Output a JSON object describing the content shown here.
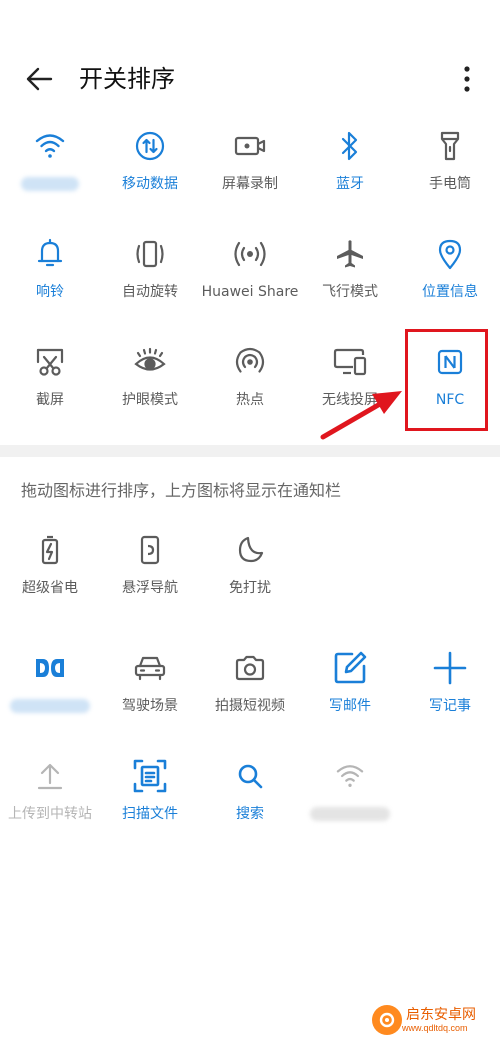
{
  "header": {
    "title": "开关排序"
  },
  "active_switches": [
    {
      "label": "",
      "icon": "wifi-icon",
      "state": "on"
    },
    {
      "label": "移动数据",
      "icon": "mobile-data-icon",
      "state": "on"
    },
    {
      "label": "屏幕录制",
      "icon": "screen-record-icon",
      "state": "off"
    },
    {
      "label": "蓝牙",
      "icon": "bluetooth-icon",
      "state": "on"
    },
    {
      "label": "手电筒",
      "icon": "flashlight-icon",
      "state": "off"
    },
    {
      "label": "响铃",
      "icon": "bell-icon",
      "state": "on"
    },
    {
      "label": "自动旋转",
      "icon": "auto-rotate-icon",
      "state": "off"
    },
    {
      "label": "Huawei Share",
      "icon": "huawei-share-icon",
      "state": "off"
    },
    {
      "label": "飞行模式",
      "icon": "airplane-icon",
      "state": "off"
    },
    {
      "label": "位置信息",
      "icon": "location-icon",
      "state": "on"
    },
    {
      "label": "截屏",
      "icon": "screenshot-icon",
      "state": "off"
    },
    {
      "label": "护眼模式",
      "icon": "eye-comfort-icon",
      "state": "off"
    },
    {
      "label": "热点",
      "icon": "hotspot-icon",
      "state": "off"
    },
    {
      "label": "无线投屏",
      "icon": "wireless-projection-icon",
      "state": "off"
    },
    {
      "label": "NFC",
      "icon": "nfc-icon",
      "state": "on"
    }
  ],
  "hint": "拖动图标进行排序，上方图标将显示在通知栏",
  "inactive_switches": [
    {
      "label": "超级省电",
      "icon": "ultra-power-saving-icon",
      "state": "off"
    },
    {
      "label": "悬浮导航",
      "icon": "floating-navigation-icon",
      "state": "off"
    },
    {
      "label": "免打扰",
      "icon": "do-not-disturb-icon",
      "state": "off"
    },
    {
      "label": "",
      "icon": "dolby-icon",
      "state": "on"
    },
    {
      "label": "驾驶场景",
      "icon": "car-icon",
      "state": "off"
    },
    {
      "label": "拍摄短视频",
      "icon": "camera-icon",
      "state": "off"
    },
    {
      "label": "写邮件",
      "icon": "write-email-icon",
      "state": "on"
    },
    {
      "label": "写记事",
      "icon": "add-note-icon",
      "state": "on"
    },
    {
      "label": "上传到中转站",
      "icon": "upload-icon",
      "state": "disabled"
    },
    {
      "label": "扫描文件",
      "icon": "scan-document-icon",
      "state": "on"
    },
    {
      "label": "搜索",
      "icon": "search-icon",
      "state": "on"
    },
    {
      "label": "",
      "icon": "wifi-icon",
      "state": "disabled"
    }
  ],
  "colors": {
    "accent": "#1a7fd8",
    "inactive": "#5c5c5c",
    "disabled": "#b5b5b5",
    "highlight": "#e0161e"
  },
  "watermark": {
    "name": "启东安卓网",
    "url": "www.qdltdq.com"
  }
}
